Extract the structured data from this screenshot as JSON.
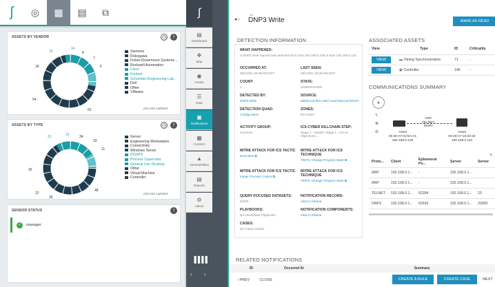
{
  "left_toolbar": {
    "logo_char": "ʃ",
    "buttons": [
      "dashboard-toggle",
      "grid-view",
      "document-view",
      "copy-view"
    ]
  },
  "vendor_panel": {
    "title": "ASSETS BY VENDOR",
    "legend": [
      {
        "label": "Siemens",
        "color": "#1f3b4d"
      },
      {
        "label": "Rokogawa",
        "color": "#1f3b4d"
      },
      {
        "label": "Fisher-Rosemount Systems...",
        "color": "#1f3b4d"
      },
      {
        "label": "Rockwell Automation",
        "color": "#1f3b4d"
      },
      {
        "label": "Cisco",
        "color": "#1a9ea8"
      },
      {
        "label": "Fortinet",
        "color": "#1a9ea8"
      },
      {
        "label": "Schneider Engineering Lab...",
        "color": "#1a9ea8"
      },
      {
        "label": "Dell",
        "color": "#1f3b4d"
      },
      {
        "label": "Other",
        "color": "#1f3b4d"
      },
      {
        "label": "VMware",
        "color": "#1f3b4d"
      }
    ],
    "not_labeled": "224 Not Labeled",
    "ring_labels": [
      "16",
      "14",
      "8",
      "7",
      "6",
      "18",
      "54",
      "62"
    ]
  },
  "type_panel": {
    "title": "ASSETS BY TYPE",
    "legend": [
      {
        "label": "Server",
        "color": "#1f3b4d"
      },
      {
        "label": "Engineering Workstation",
        "color": "#1f3b4d"
      },
      {
        "label": "Connectivity",
        "color": "#1f3b4d"
      },
      {
        "label": "Windows Server",
        "color": "#1f3b4d"
      },
      {
        "label": "IDS/IPS",
        "color": "#1a9ea8"
      },
      {
        "label": "Process Supervisor",
        "color": "#1a9ea8"
      },
      {
        "label": "General Use Desktop",
        "color": "#1a9ea8"
      },
      {
        "label": "Other",
        "color": "#1f3b4d"
      },
      {
        "label": "Virtual Machine",
        "color": "#1f3b4d"
      },
      {
        "label": "Controller",
        "color": "#1f3b4d"
      }
    ],
    "not_labeled": "235 Not Labeled",
    "ring_labels": [
      "21",
      "31",
      "34",
      "33",
      "11",
      "26",
      "22",
      "36",
      "48"
    ]
  },
  "sensor_panel": {
    "title": "SENSOR STATUS",
    "sensor": "manager"
  },
  "sidenav": [
    {
      "label": "Dashboard",
      "icon": "▤"
    },
    {
      "label": "Map",
      "icon": "❖"
    },
    {
      "label": "Assets",
      "icon": "◉"
    },
    {
      "label": "Data",
      "icon": "☰"
    },
    {
      "label": "Notifications",
      "icon": "▣"
    },
    {
      "label": "Content",
      "icon": "▦"
    },
    {
      "label": "Vulnerabilities",
      "icon": "▲"
    },
    {
      "label": "Reports",
      "icon": "▤"
    },
    {
      "label": "Admin",
      "icon": "⚙"
    }
  ],
  "header": {
    "id_small": "12",
    "title": "DNP3 Write",
    "mark_read": "MARK AS READ"
  },
  "detection": {
    "title": "DETECTION INFORMATION",
    "what_label": "WHAT HAPPENED:",
    "what_value": "A DNP3 write request was detected from host 192.168.0.108 to host 192.168.0.110",
    "occurred_label": "OCCURRED AT:",
    "occurred_value": "09/12/20, 09:39 PM EDT",
    "last_seen_label": "LAST SEEN:",
    "last_seen_value": "09/12/20, 09:39 PM EDT",
    "count_label": "COUNT:",
    "count_value": "1",
    "state_label": "STATE:",
    "state_value": "UNRESOLVED",
    "detected_label": "DETECTED BY:",
    "detected_value": "DNP3 Write",
    "source_label": "SOURCE:",
    "source_value": "6d5dec15-f91c-4827-aa1f-59e14e752407",
    "quad_label": "DETECTION QUAD:",
    "quad_value": "Configuration",
    "zones_label": "ZONES:",
    "zones_value": "RFC1918",
    "activity_label": "ACTIVITY GROUP:",
    "activity_value": "Common",
    "kill_label": "ICS CYBER KILLCHAIN STEP:",
    "kill_value": "Stage 1 - Exploit; Stage 1 - Act on Objectives;...",
    "mitre1_label": "MITRE ATTACK FOR ICS TACTIC",
    "mitre1_value": "Execution ⧉",
    "mitre2_label": "MITRE ATT&CK FOR ICS TECHNIQUE",
    "mitre2_value": "T0875: Change Program State ⧉",
    "mitre3_label": "MITRE ATTACK FOR ICS TACTIC",
    "mitre3_value": "Impair Process Control ⧉",
    "mitre4_label": "MITRE ATT&CK FOR ICS TECHNIQUE",
    "mitre4_value": "T0875: Change Program State ⧉",
    "query_label": "QUERY-FOCUSED DATASETS:",
    "query_value": "DNP3",
    "notif_label": "NOTIFICATION RECORD:",
    "notif_value": "View in Kibana",
    "playbooks_label": "PLAYBOOKS:",
    "playbooks_value": "No Associated Playbooks",
    "components_label": "NOTIFICATION COMPONENTS:",
    "components_value": "View in Kibana",
    "cases_label": "CASES:",
    "cases_value": "No Cases Linked"
  },
  "assets": {
    "title": "ASSOCIATED ASSETS",
    "headers": [
      "View",
      "Type",
      "ID",
      "Criticality"
    ],
    "rows": [
      {
        "view": "VIEW",
        "type": "Timing Synchronization",
        "id": "71",
        "crit": "-"
      },
      {
        "view": "VIEW",
        "type": "Controller",
        "id": "146",
        "crit": "-"
      }
    ]
  },
  "comms": {
    "title": "COMMUNICATIONS SUMMARY",
    "edge_label": "ARP\nTELNET\nDNP3",
    "asset_a_title": "Asset",
    "asset_a_mac": "00:30:A7:02:5A:A1",
    "asset_a_ip": "192.168.0.100",
    "asset_b_title": "Asset",
    "asset_b_mac": "00:30:A7:16:32:32",
    "asset_b_ip": "192.168.0.110",
    "headers": [
      "Proto...",
      "Client",
      "Ephemeral Po...",
      "Server",
      "Server"
    ],
    "rows": [
      [
        "ARP",
        "192.168.0.1...",
        "-",
        "192.168.0.1...",
        ""
      ],
      [
        "ARP",
        "192.168.0.1...",
        "-",
        "192.168.0.1...",
        ""
      ],
      [
        "TELNET",
        "192.168.0.1...",
        "52394",
        "192.168.0.1...",
        "23"
      ],
      [
        "DNP3",
        "192.168.0.1...",
        "52626",
        "192.168.0.1...",
        "20000"
      ]
    ]
  },
  "related": {
    "title": "RELATED NOTIFICATIONS",
    "headers": [
      "ID",
      "Occurred At",
      "Summary"
    ]
  },
  "footer": {
    "prev": "PREV",
    "close": "CLOSE",
    "create_rule": "CREATE A RULE",
    "create_case": "CREATE CASE",
    "next": "NEXT"
  },
  "colors": {
    "teal": "#1a9ea8",
    "navy": "#1f3b4d",
    "blue_btn": "#1f8fbf",
    "green": "#3aa845"
  }
}
